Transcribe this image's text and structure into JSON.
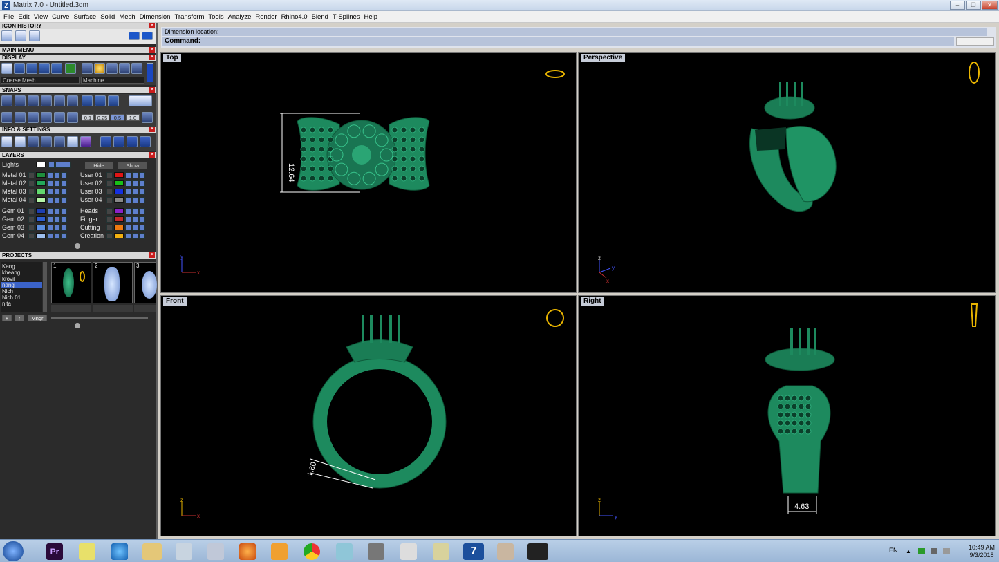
{
  "window": {
    "title": "Matrix 7.0 - Untitled.3dm",
    "app_icon": "Z"
  },
  "menu": [
    "File",
    "Edit",
    "View",
    "Curve",
    "Surface",
    "Solid",
    "Mesh",
    "Dimension",
    "Transform",
    "Tools",
    "Analyze",
    "Render",
    "Rhino4.0",
    "Blend",
    "T-Splines",
    "Help"
  ],
  "panels": {
    "icon_history": "ICON HISTORY",
    "main_menu": "MAIN MENU",
    "display": "DISPLAY",
    "display_mode": "Coarse Mesh",
    "display_material": "Machine",
    "snaps": "SNAPS",
    "snap_values": [
      "0.1",
      "0.25",
      "0.5",
      "1.0"
    ],
    "info_settings": "INFO & SETTINGS",
    "layers": "LAYERS",
    "lights": "Lights",
    "hide": "Hide",
    "show": "Show",
    "layers_left": [
      {
        "name": "Metal 01",
        "color": "#1f8f3c"
      },
      {
        "name": "Metal 02",
        "color": "#23a85a"
      },
      {
        "name": "Metal 03",
        "color": "#62d86e"
      },
      {
        "name": "Metal 04",
        "color": "#b6f5a8"
      },
      {
        "name": "Gem 01",
        "color": "#1e3fb0"
      },
      {
        "name": "Gem 02",
        "color": "#2e5fd0"
      },
      {
        "name": "Gem 03",
        "color": "#5b8ee0"
      },
      {
        "name": "Gem 04",
        "color": "#9ec0ee"
      }
    ],
    "layers_right": [
      {
        "name": "User 01",
        "color": "#e01515"
      },
      {
        "name": "User 02",
        "color": "#18c018"
      },
      {
        "name": "User 03",
        "color": "#1530e0"
      },
      {
        "name": "User 04",
        "color": "#888888"
      },
      {
        "name": "Heads",
        "color": "#8a22c8"
      },
      {
        "name": "Finger",
        "color": "#c02a2a"
      },
      {
        "name": "Cutting",
        "color": "#f07a10"
      },
      {
        "name": "Creation",
        "color": "#f0b010"
      }
    ],
    "projects": "PROJECTS",
    "project_list": [
      "Kang",
      "kheang",
      "krovil",
      "nang",
      "Nich",
      "Nich 01",
      "nita"
    ],
    "project_selected": "nang",
    "thumb_numbers": [
      "1",
      "2",
      "3"
    ],
    "mngr": "Mngr"
  },
  "command": {
    "line1": "Dimension location:",
    "line2": "Command:"
  },
  "viewports": [
    {
      "name": "Top",
      "dimension": "12.64",
      "axis_a": "y",
      "axis_b": "x"
    },
    {
      "name": "Perspective",
      "axis_a": "z",
      "axis_b": "y",
      "axis_c": "x"
    },
    {
      "name": "Front",
      "dimension": "1.60",
      "axis_a": "z",
      "axis_b": "x"
    },
    {
      "name": "Right",
      "dimension": "4.63",
      "axis_a": "z",
      "axis_b": "y"
    }
  ],
  "taskbar": {
    "lang": "EN",
    "time": "10:49 AM",
    "date": "9/3/2018",
    "premiere_label": "Pr"
  },
  "colors": {
    "model": "#1d8a5e",
    "model_dark": "#0e5a3a",
    "accent": "#e8b400",
    "viewport_bg": "#000000"
  }
}
